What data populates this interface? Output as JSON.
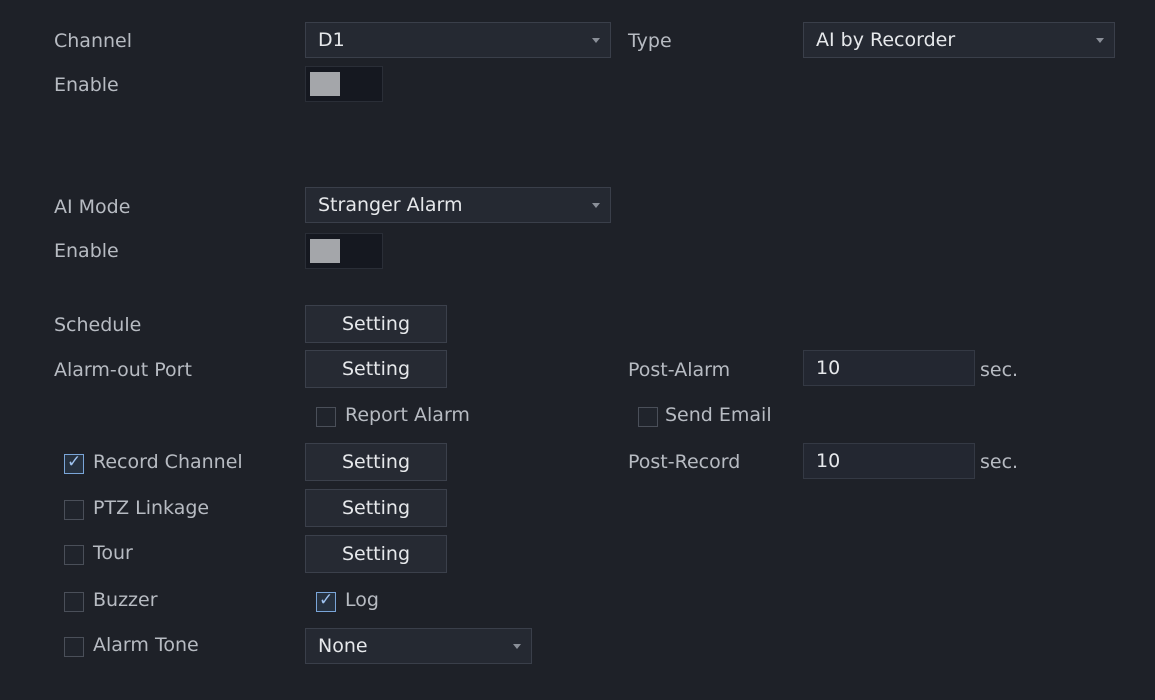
{
  "channel": {
    "label": "Channel",
    "value": "D1"
  },
  "type": {
    "label": "Type",
    "value": "AI by Recorder"
  },
  "enable1": {
    "label": "Enable"
  },
  "ai_mode": {
    "label": "AI Mode",
    "value": "Stranger Alarm"
  },
  "enable2": {
    "label": "Enable"
  },
  "schedule": {
    "label": "Schedule",
    "button": "Setting"
  },
  "alarm_out": {
    "label": "Alarm-out Port",
    "button": "Setting"
  },
  "post_alarm": {
    "label": "Post-Alarm",
    "value": "10",
    "unit": "sec."
  },
  "report_alarm": {
    "label": "Report Alarm"
  },
  "send_email": {
    "label": "Send Email"
  },
  "record_channel": {
    "label": "Record Channel",
    "button": "Setting"
  },
  "post_record": {
    "label": "Post-Record",
    "value": "10",
    "unit": "sec."
  },
  "ptz_linkage": {
    "label": "PTZ Linkage",
    "button": "Setting"
  },
  "tour": {
    "label": "Tour",
    "button": "Setting"
  },
  "buzzer": {
    "label": "Buzzer"
  },
  "log": {
    "label": "Log"
  },
  "alarm_tone": {
    "label": "Alarm Tone",
    "value": "None"
  },
  "check_glyph": "✓"
}
